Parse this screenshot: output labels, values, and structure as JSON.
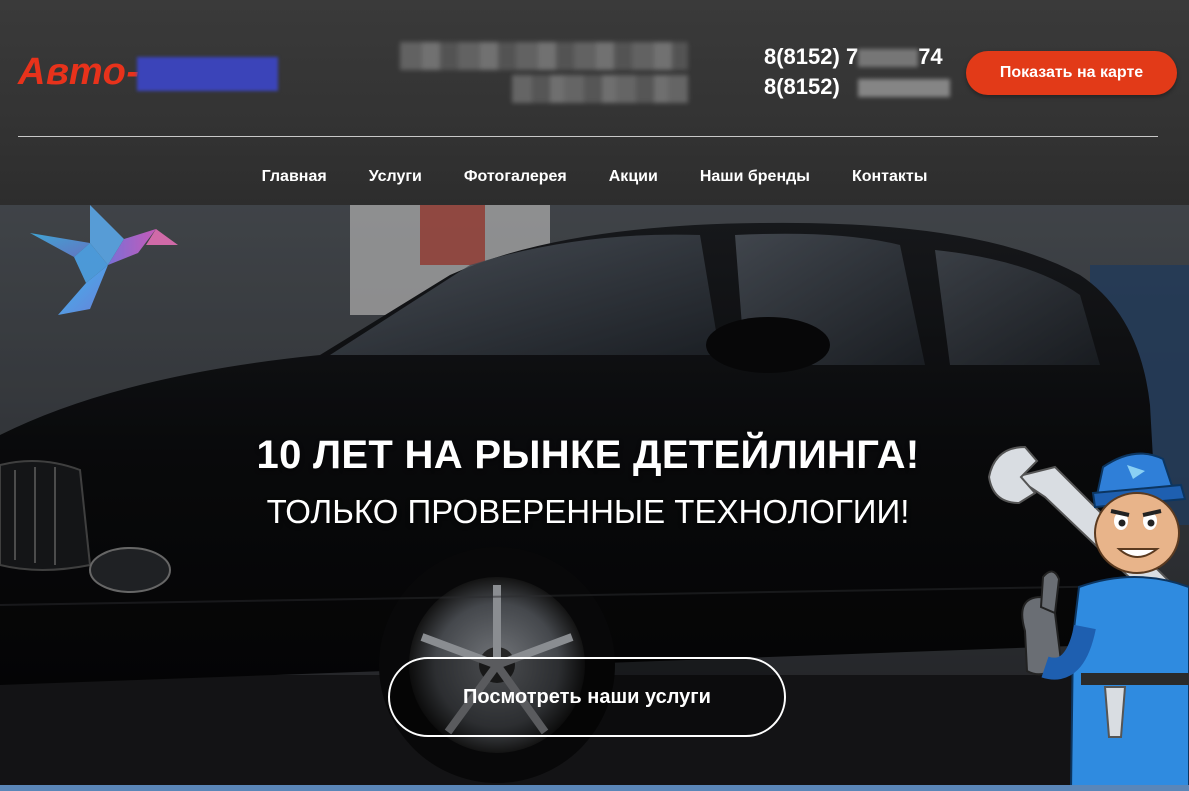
{
  "header": {
    "logo_text": "Авто-",
    "phones": [
      "8(8152) 7",
      "8(8152)"
    ],
    "phone_tail_1": "74",
    "map_button": "Показать на карте"
  },
  "nav": {
    "items": [
      "Главная",
      "Услуги",
      "Фотогалерея",
      "Акции",
      "Наши бренды",
      "Контакты"
    ]
  },
  "hero": {
    "title": "10 ЛЕТ НА РЫНКЕ ДЕТЕЙЛИНГА!",
    "subtitle": "ТОЛЬКО ПРОВЕРЕННЫЕ ТЕХНОЛОГИИ!",
    "cta": "Посмотреть наши услуги"
  },
  "colors": {
    "accent": "#e23a18",
    "logo": "#e8321b",
    "header_bg": "#333333"
  }
}
